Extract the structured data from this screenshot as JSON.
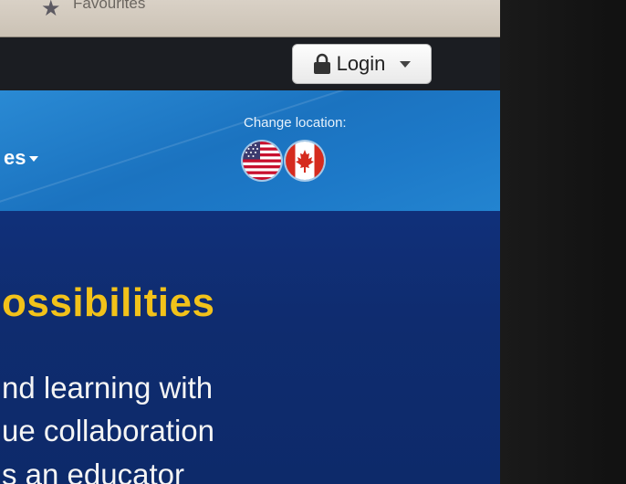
{
  "favourites_bar": {
    "label": "Favourites"
  },
  "top_nav": {
    "login_label": "Login"
  },
  "header": {
    "nav_item_partial": "es",
    "change_location_label": "Change location:",
    "flags": [
      "us-flag-icon",
      "canada-flag-icon"
    ]
  },
  "hero": {
    "title_partial": "ossibilities",
    "lines": [
      "nd learning with",
      "ue collaboration",
      "s an educator"
    ]
  },
  "colors": {
    "header_blue": "#1b73c0",
    "hero_navy": "#0f2c6f",
    "title_yellow": "#f2c21a"
  }
}
